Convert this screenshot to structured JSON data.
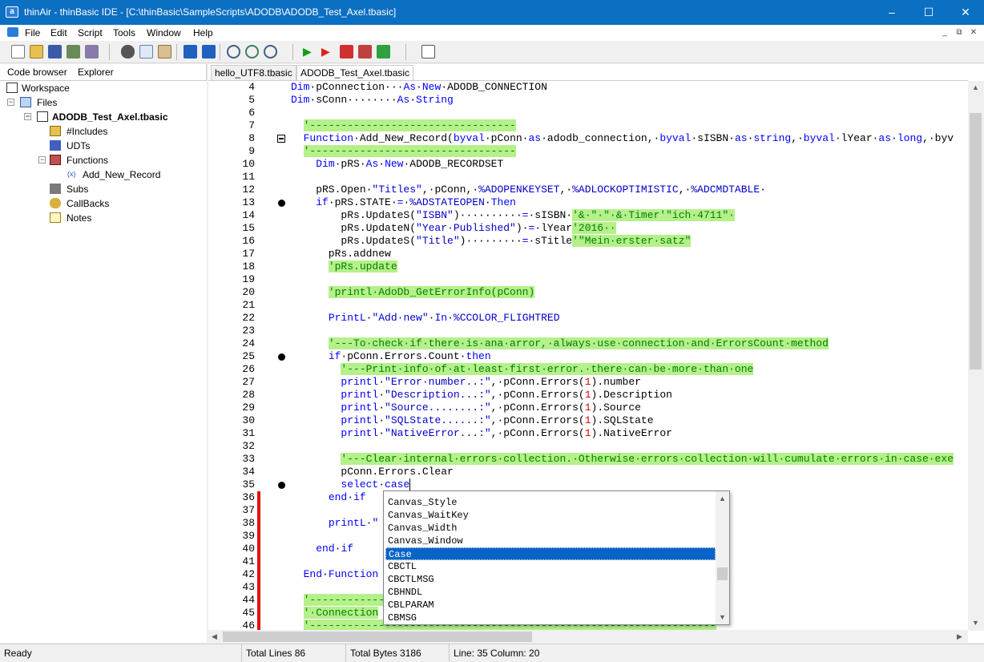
{
  "window": {
    "title": "thinAir - thinBasic IDE - [C:\\thinBasic\\SampleScripts\\ADODB\\ADODB_Test_Axel.tbasic]",
    "app_icon": "a",
    "min": "–",
    "max": "☐",
    "close": "✕"
  },
  "menu": [
    "File",
    "Edit",
    "Script",
    "Tools",
    "Window",
    "Help"
  ],
  "mdi": {
    "minimize": "_",
    "restore": "⧉",
    "close": "✕"
  },
  "left_tabs": [
    "Code browser",
    "Explorer"
  ],
  "tree": {
    "workspace": "Workspace",
    "files": "Files",
    "file": "ADODB_Test_Axel.tbasic",
    "includes": "#Includes",
    "udts": "UDTs",
    "functions": "Functions",
    "function_item": "Add_New_Record",
    "subs": "Subs",
    "callbacks": "CallBacks",
    "notes": "Notes"
  },
  "editor_tabs": [
    "hello_UTF8.tbasic",
    "ADODB_Test_Axel.tbasic"
  ],
  "code_lines": [
    {
      "n": "4",
      "t": "Dim·pConnection···As·New·ADODB_CONNECTION"
    },
    {
      "n": "5",
      "t": "Dim·sConn········As·String"
    },
    {
      "n": "6",
      "t": ""
    },
    {
      "n": "7",
      "t": "  '---------------------------------"
    },
    {
      "n": "8",
      "t": "  Function·Add_New_Record(byval·pConn·as·adodb_connection,·byval·sISBN·as·string,·byval·lYear·as·long,·byv"
    },
    {
      "n": "9",
      "t": "  '---------------------------------"
    },
    {
      "n": "10",
      "t": "    Dim·pRS·As·New·ADODB_RECORDSET"
    },
    {
      "n": "11",
      "t": ""
    },
    {
      "n": "12",
      "t": "    pRS.Open·\"Titles\",·pConn,·%ADOPENKEYSET,·%ADLOCKOPTIMISTIC,·%ADCMDTABLE·"
    },
    {
      "n": "13",
      "t": "    if·pRS.STATE·=·%ADSTATEOPEN·Then"
    },
    {
      "n": "14",
      "t": "        pRs.UpdateS(\"ISBN\")··········=·sISBN·'&·\"·\"·&·Timer'\"ich·4711\"·"
    },
    {
      "n": "15",
      "t": "        pRs.UpdateN(\"Year·Published\")·=·lYear'2016··"
    },
    {
      "n": "16",
      "t": "        pRs.UpdateS(\"Title\")·········=·sTitle'\"Mein·erster·satz\""
    },
    {
      "n": "17",
      "t": "      pRs.addnew"
    },
    {
      "n": "18",
      "t": "      'pRs.update"
    },
    {
      "n": "19",
      "t": ""
    },
    {
      "n": "20",
      "t": "      'printl·AdoDb_GetErrorInfo(pConn)"
    },
    {
      "n": "21",
      "t": ""
    },
    {
      "n": "22",
      "t": "      PrintL·\"Add·new\"·In·%CCOLOR_FLIGHTRED"
    },
    {
      "n": "23",
      "t": ""
    },
    {
      "n": "24",
      "t": "      '---To·check·if·there·is·ana·arror,·always·use·connection·and·ErrorsCount·method"
    },
    {
      "n": "25",
      "t": "      if·pConn.Errors.Count·then"
    },
    {
      "n": "26",
      "t": "        '---Print·info·of·at·least·first·error.·there·can·be·more·than·one"
    },
    {
      "n": "27",
      "t": "        printl·\"Error·number..:\",·pConn.Errors(1).number"
    },
    {
      "n": "28",
      "t": "        printl·\"Description...:\",·pConn.Errors(1).Description"
    },
    {
      "n": "29",
      "t": "        printl·\"Source........:\",·pConn.Errors(1).Source"
    },
    {
      "n": "30",
      "t": "        printl·\"SQLState......:\",·pConn.Errors(1).SQLState"
    },
    {
      "n": "31",
      "t": "        printl·\"NativeError...:\",·pConn.Errors(1).NativeError"
    },
    {
      "n": "32",
      "t": ""
    },
    {
      "n": "33",
      "t": "        '---Clear·internal·errors·collection.·Otherwise·errors·collection·will·cumulate·errors·in·case·exe"
    },
    {
      "n": "34",
      "t": "        pConn.Errors.Clear"
    },
    {
      "n": "35",
      "t": "        select·case"
    },
    {
      "n": "36",
      "t": "      end·if"
    },
    {
      "n": "37",
      "t": ""
    },
    {
      "n": "38",
      "t": "      printL·\""
    },
    {
      "n": "39",
      "t": ""
    },
    {
      "n": "40",
      "t": "    end·if"
    },
    {
      "n": "41",
      "t": ""
    },
    {
      "n": "42",
      "t": "  End·Function"
    },
    {
      "n": "43",
      "t": ""
    },
    {
      "n": "44",
      "t": "  '------------"
    },
    {
      "n": "45",
      "t": "  '·Connection"
    },
    {
      "n": "46",
      "t": "  '-----------------------------------------------------------------"
    }
  ],
  "autocomplete": [
    "Canvas_Style",
    "Canvas_WaitKey",
    "Canvas_Width",
    "Canvas_Window",
    "Case",
    "CBCTL",
    "CBCTLMSG",
    "CBHNDL",
    "CBLPARAM",
    "CBMSG"
  ],
  "autocomplete_selected": "Case",
  "status": {
    "ready": "Ready",
    "lines": "Total Lines 86",
    "bytes": "Total Bytes 3186",
    "pos": "Line: 35 Column: 20"
  }
}
